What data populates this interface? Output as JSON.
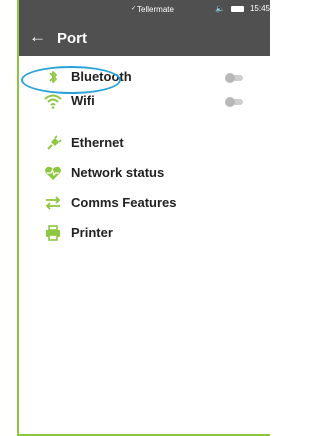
{
  "status_bar": {
    "brand": "Tellermate",
    "time": "15:45",
    "volume_icon": "volume-icon",
    "battery_icon": "battery-icon"
  },
  "app_bar": {
    "back_icon": "arrow-left-icon",
    "title": "Port"
  },
  "menu": {
    "items": [
      {
        "label": "Bluetooth",
        "icon": "bluetooth-icon",
        "toggle": false
      },
      {
        "label": "Wifi",
        "icon": "wifi-icon",
        "toggle": false
      },
      {
        "label": "Ethernet",
        "icon": "plug-icon"
      },
      {
        "label": "Network status",
        "icon": "heartbeat-icon"
      },
      {
        "label": "Comms Features",
        "icon": "exchange-icon"
      },
      {
        "label": "Printer",
        "icon": "printer-icon"
      }
    ]
  },
  "colors": {
    "accent": "#8dc63f",
    "header_bg": "#505050",
    "highlight_ring": "#2aa3d8"
  }
}
